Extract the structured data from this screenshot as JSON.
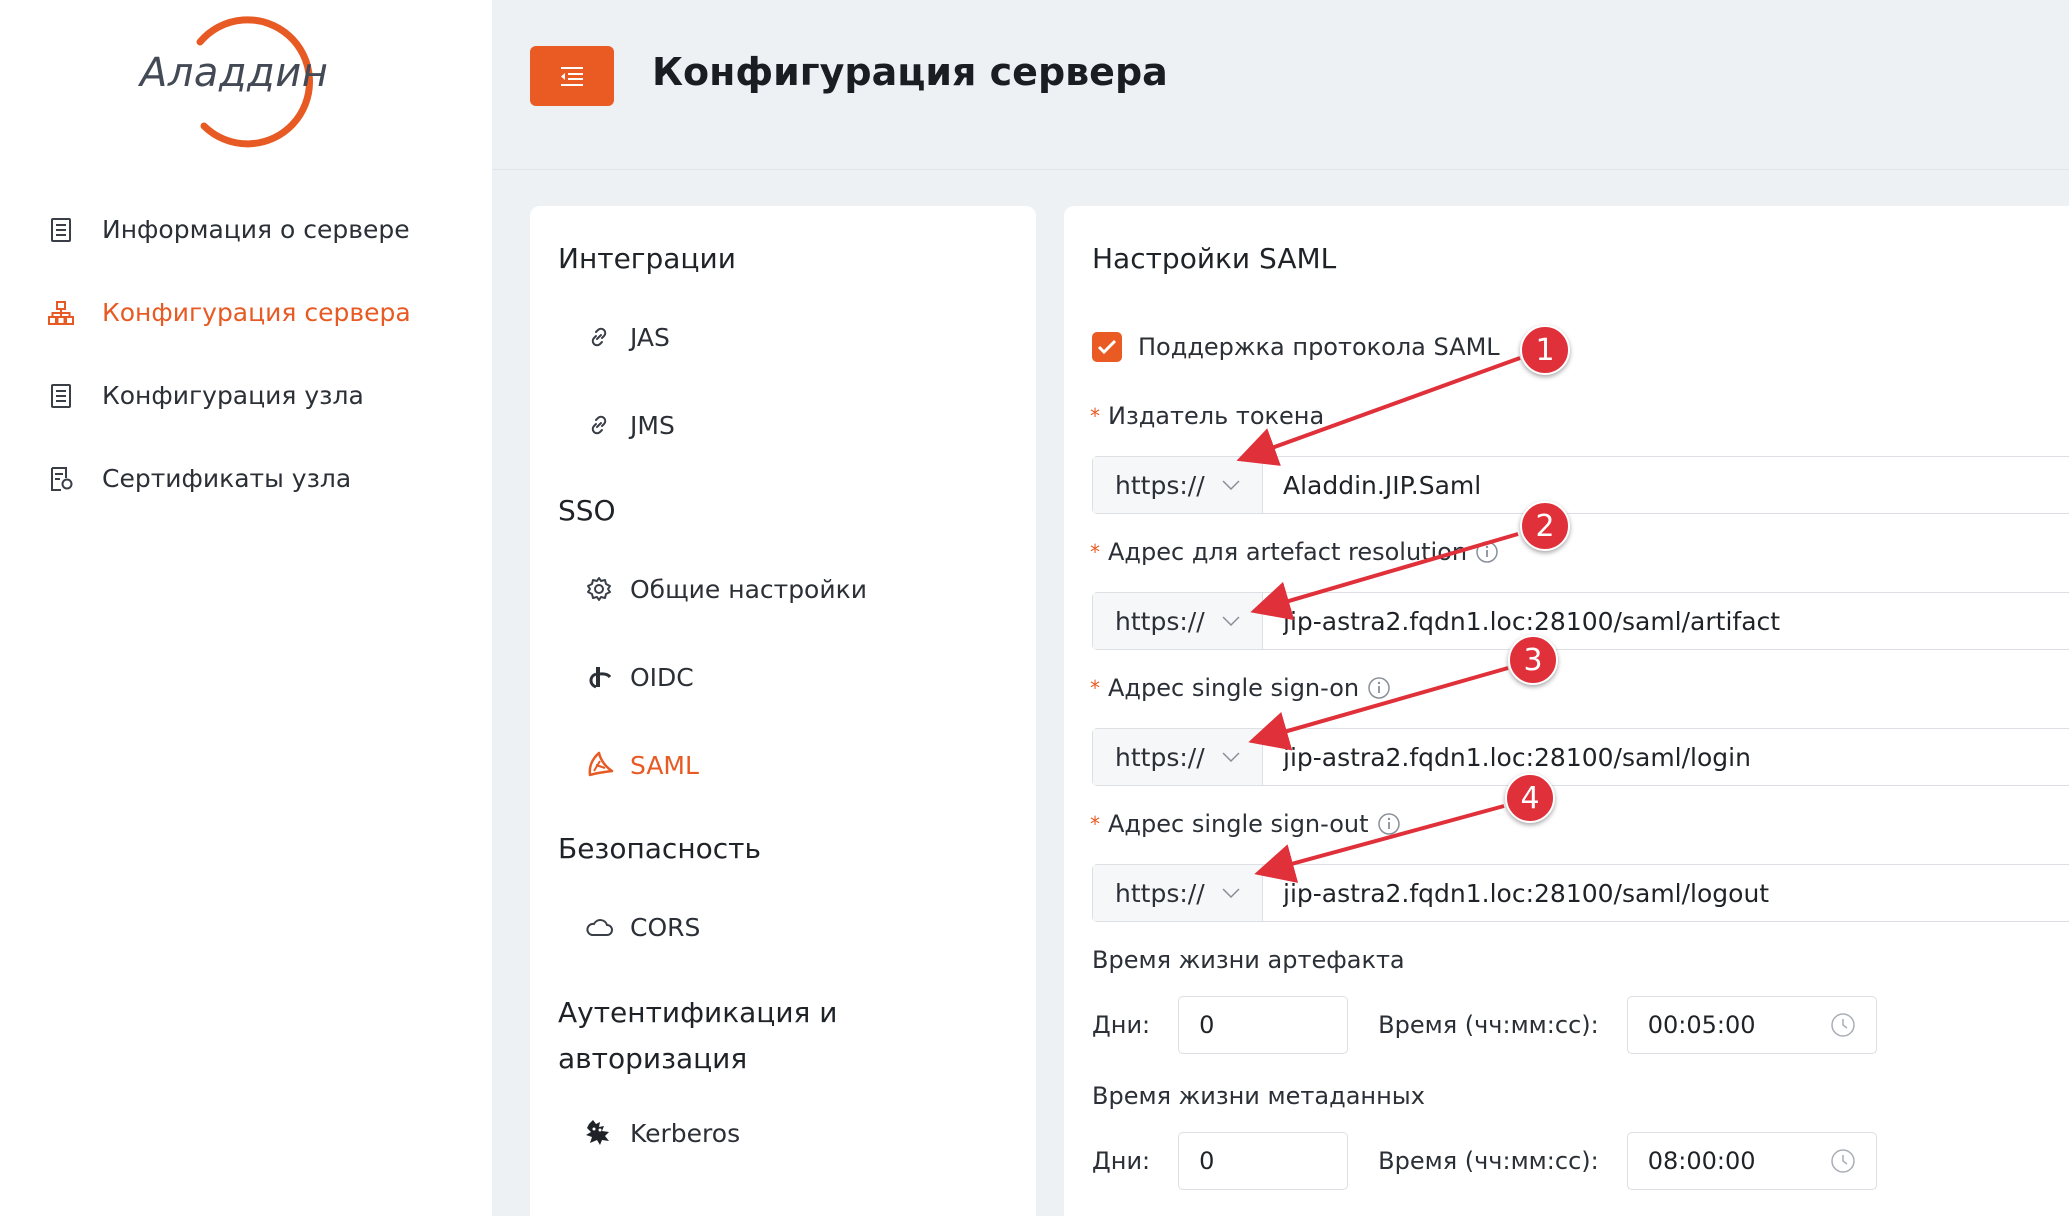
{
  "app": {
    "logo_text": "Аладдин",
    "brand_color": "#ea5b24"
  },
  "sidebar": {
    "items": [
      {
        "label": "Информация о сервере",
        "icon": "document-list-icon",
        "active": false
      },
      {
        "label": "Конфигурация сервера",
        "icon": "network-icon",
        "active": true
      },
      {
        "label": "Конфигурация узла",
        "icon": "document-list-icon",
        "active": false
      },
      {
        "label": "Сертификаты узла",
        "icon": "certificate-icon",
        "active": false
      }
    ]
  },
  "header": {
    "title": "Конфигурация сервера",
    "menu_icon": "menu-collapse-icon"
  },
  "integrations": {
    "sections": [
      {
        "title": "Интеграции",
        "items": [
          {
            "label": "JAS",
            "icon": "link-icon"
          },
          {
            "label": "JMS",
            "icon": "link-icon"
          }
        ]
      },
      {
        "title": "SSO",
        "items": [
          {
            "label": "Общие настройки",
            "icon": "gear-icon"
          },
          {
            "label": "OIDC",
            "icon": "oidc-icon"
          },
          {
            "label": "SAML",
            "icon": "saml-icon",
            "active": true
          }
        ]
      },
      {
        "title": "Безопасность",
        "items": [
          {
            "label": "CORS",
            "icon": "cloud-icon"
          }
        ]
      },
      {
        "title_line1": "Аутентификация и",
        "title_line2": "авторизация",
        "items": [
          {
            "label": "Kerberos",
            "icon": "kerberos-icon"
          }
        ]
      }
    ]
  },
  "saml": {
    "title": "Настройки SAML",
    "support_label": "Поддержка протокола SAML",
    "support_checked": true,
    "fields": [
      {
        "label": "Издатель токена",
        "protocol": "https://",
        "value": "Aladdin.JIP.Saml",
        "info": false
      },
      {
        "label": "Адрес для artefact resolution",
        "protocol": "https://",
        "value": "jip-astra2.fqdn1.loc:28100/saml/artifact",
        "info": true
      },
      {
        "label": "Адрес single sign-on",
        "protocol": "https://",
        "value": "jip-astra2.fqdn1.loc:28100/saml/login",
        "info": true
      },
      {
        "label": "Адрес single sign-out",
        "protocol": "https://",
        "value": "jip-astra2.fqdn1.loc:28100/saml/logout",
        "info": true
      }
    ],
    "artifact_lifetime": {
      "label": "Время жизни артефакта",
      "days_label": "Дни:",
      "days": "0",
      "time_label": "Время (чч:мм:сс):",
      "time": "00:05:00"
    },
    "metadata_lifetime": {
      "label": "Время жизни метаданных",
      "days_label": "Дни:",
      "days": "0",
      "time_label": "Время (чч:мм:сс):",
      "time": "08:00:00"
    }
  },
  "annotations": {
    "badges": [
      "1",
      "2",
      "3",
      "4"
    ],
    "color": "#e0303a"
  }
}
